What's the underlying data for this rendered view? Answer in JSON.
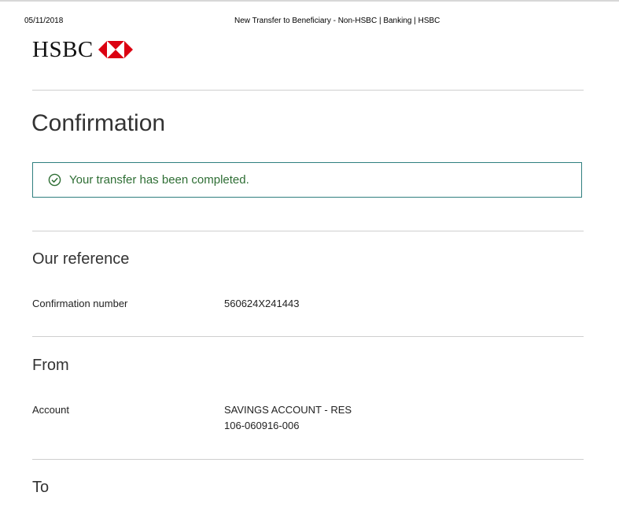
{
  "print_header": {
    "date": "05/11/2018",
    "page_title": "New Transfer to Beneficiary - Non-HSBC | Banking | HSBC"
  },
  "brand": {
    "name": "HSBC",
    "colors": {
      "hexagon_red": "#db0011",
      "notice_border": "#2f7f7f",
      "success_text": "#2e6e34"
    }
  },
  "page": {
    "title": "Confirmation"
  },
  "notice": {
    "icon": "check-circle-icon",
    "text": "Your transfer has been completed."
  },
  "sections": {
    "reference": {
      "heading": "Our reference",
      "label": "Confirmation number",
      "value": "560624X241443"
    },
    "from": {
      "heading": "From",
      "label": "Account",
      "account_name": "SAVINGS ACCOUNT - RES",
      "account_number": "106-060916-006"
    },
    "to": {
      "heading": "To"
    }
  }
}
